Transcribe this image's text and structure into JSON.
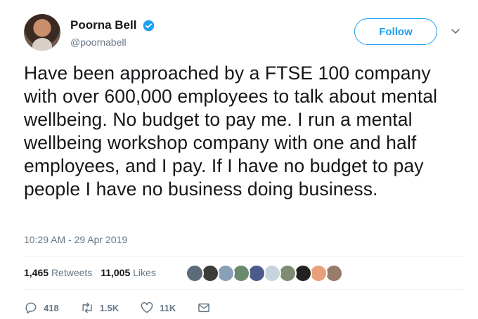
{
  "user": {
    "display_name": "Poorna Bell",
    "handle": "@poornabell",
    "verified": true
  },
  "follow_button": {
    "label": "Follow"
  },
  "tweet": {
    "text": "Have been approached by a FTSE 100 company with over 600,000 employees to talk about mental wellbeing. No budget to pay me. I run a mental wellbeing workshop company with one and half employees, and I pay. If I have no budget to pay people I have no business doing business.",
    "timestamp": "10:29 AM - 29 Apr 2019"
  },
  "stats": {
    "retweets_count": "1,465",
    "retweets_label": "Retweets",
    "likes_count": "11,005",
    "likes_label": "Likes"
  },
  "likers": [
    {
      "color": "#5b6b7a"
    },
    {
      "color": "#3c3c3c"
    },
    {
      "color": "#8aa0b8"
    },
    {
      "color": "#6c8a6e"
    },
    {
      "color": "#4a5a8a"
    },
    {
      "color": "#c8d4dc"
    },
    {
      "color": "#7e8c74"
    },
    {
      "color": "#222222"
    },
    {
      "color": "#e8a07a"
    },
    {
      "color": "#9a7a6a"
    }
  ],
  "actions": {
    "replies": "418",
    "retweets": "1.5K",
    "likes": "11K"
  },
  "colors": {
    "accent": "#1da1f2",
    "secondary_text": "#657786",
    "divider": "#e6ecf0"
  }
}
